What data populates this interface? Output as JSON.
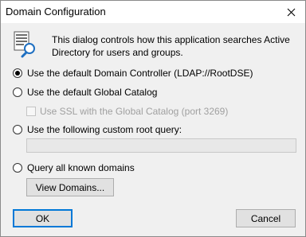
{
  "window": {
    "title": "Domain Configuration",
    "close_glyph": "×"
  },
  "info": {
    "icon": "directory-search-icon",
    "text": "This dialog controls how this application searches Active Directory for users and groups."
  },
  "options": {
    "default_dc": {
      "label": "Use the default Domain Controller (LDAP://RootDSE)",
      "selected": true
    },
    "global_catalog": {
      "label": "Use the default Global Catalog",
      "selected": false
    },
    "use_ssl": {
      "label": "Use SSL with the Global Catalog (port 3269)",
      "checked": false,
      "enabled": false
    },
    "custom_root": {
      "label": "Use the following custom root query:",
      "selected": false
    },
    "custom_root_value": "",
    "all_domains": {
      "label": "Query all known domains",
      "selected": false
    }
  },
  "buttons": {
    "view_domains": "View Domains...",
    "ok": "OK",
    "cancel": "Cancel"
  },
  "colors": {
    "dialog_bg": "#f0f0f0",
    "accent": "#0078d7",
    "icon_blue": "#1e6fc1"
  }
}
